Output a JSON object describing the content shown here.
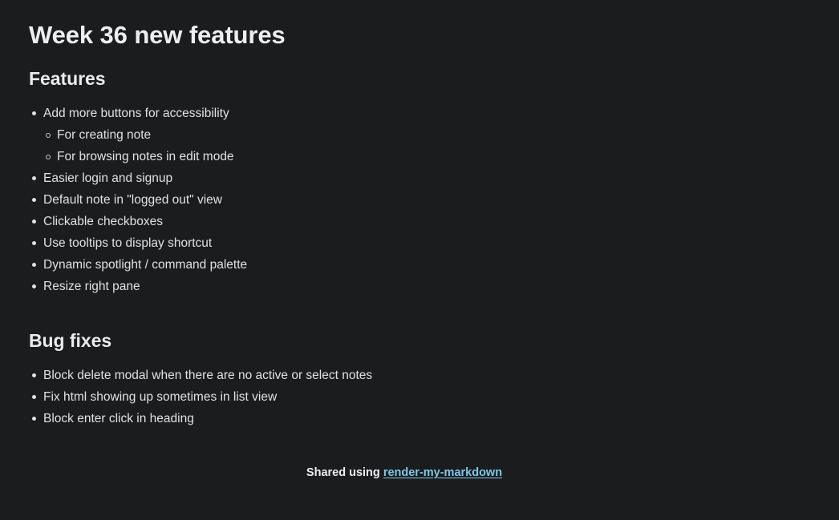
{
  "theme": {
    "background": "#1a1c1e",
    "text": "#dfe1e2",
    "heading": "#eceeef",
    "link": "#7ec8e8"
  },
  "document": {
    "title": "Week 36 new features",
    "sections": [
      {
        "heading": "Features",
        "items": [
          {
            "text": "Add more buttons for accessibility",
            "level": 1
          },
          {
            "text": "For creating note",
            "level": 2
          },
          {
            "text": "For browsing notes in edit mode",
            "level": 2
          },
          {
            "text": "Easier login and signup",
            "level": 1
          },
          {
            "text": "Default note in \"logged out\" view",
            "level": 1
          },
          {
            "text": "Clickable checkboxes",
            "level": 1
          },
          {
            "text": "Use tooltips to display shortcut",
            "level": 1
          },
          {
            "text": "Dynamic spotlight / command palette",
            "level": 1
          },
          {
            "text": "Resize right pane",
            "level": 1
          }
        ]
      },
      {
        "heading": "Bug fixes",
        "items": [
          {
            "text": "Block delete modal when there are no active or select notes",
            "level": 1
          },
          {
            "text": "Fix html showing up sometimes in list view",
            "level": 1
          },
          {
            "text": "Block enter click in heading",
            "level": 1
          }
        ]
      }
    ]
  },
  "footer": {
    "prefix": "Shared using ",
    "link_label": "render-my-markdown"
  }
}
